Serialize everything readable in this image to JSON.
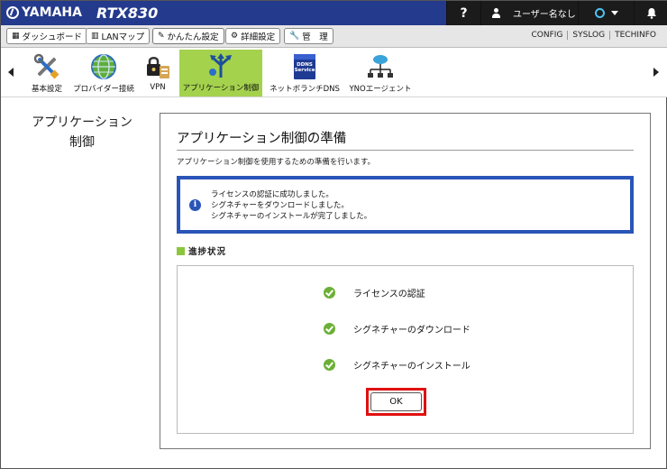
{
  "header": {
    "brand": "YAMAHA",
    "model": "RTX830",
    "help_label": "?",
    "user_label": "ユーザー名なし"
  },
  "menubar": {
    "buttons": [
      {
        "label": "ダッシュボード",
        "icon": "dashboard-icon"
      },
      {
        "label": "LANマップ",
        "icon": "lanmap-icon"
      },
      {
        "label": "かんたん設定",
        "icon": "wizard-icon"
      },
      {
        "label": "詳細設定",
        "icon": "gear-icon"
      },
      {
        "label": "管　理",
        "icon": "wrench-icon"
      }
    ],
    "links": [
      "CONFIG",
      "SYSLOG",
      "TECHINFO"
    ]
  },
  "toolbar": {
    "items": [
      {
        "label": "基本設定",
        "icon": "tools-icon"
      },
      {
        "label": "プロバイダー接続",
        "icon": "globe-icon"
      },
      {
        "label": "VPN",
        "icon": "vpn-lock-icon"
      },
      {
        "label": "アプリケーション制御",
        "icon": "app-control-icon"
      },
      {
        "label": "ネットボランチDNS",
        "icon": "ddns-service-icon"
      },
      {
        "label": "YNOエージェント",
        "icon": "network-cloud-icon"
      }
    ],
    "ddns_badge_top": "DDNS",
    "ddns_badge_bottom": "Service",
    "active_index": 3
  },
  "sidebar": {
    "title_line1": "アプリケーション",
    "title_line2": "制御"
  },
  "main": {
    "title": "アプリケーション制御の準備",
    "description": "アプリケーション制御を使用するための準備を行います。",
    "info_lines": [
      "ライセンスの認証に成功しました。",
      "シグネチャーをダウンロードしました。",
      "シグネチャーのインストールが完了しました。"
    ],
    "info_icon": "i",
    "progress_heading": "進捗状況",
    "steps": [
      {
        "label": "ライセンスの認証",
        "status": "done"
      },
      {
        "label": "シグネチャーのダウンロード",
        "status": "done"
      },
      {
        "label": "シグネチャーのインストール",
        "status": "done"
      }
    ],
    "ok_label": "OK"
  },
  "colors": {
    "header_bg": "#243a8c",
    "active_tool_bg": "#a4d24d",
    "info_border": "#2a55b8",
    "check_green": "#6bb036",
    "highlight_red": "#e01010"
  }
}
